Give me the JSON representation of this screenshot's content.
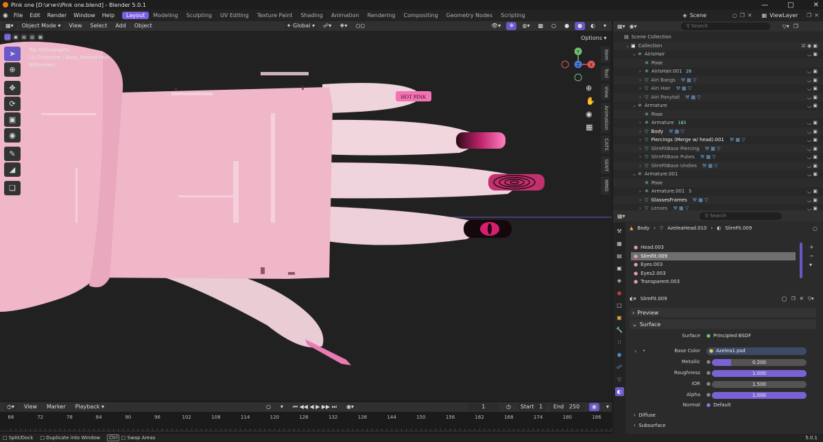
{
  "window": {
    "title": "Pink one [D:\\สาคร\\Pink one.blend] - Blender 5.0.1"
  },
  "menu": [
    "File",
    "Edit",
    "Render",
    "Window",
    "Help"
  ],
  "workspaces": [
    "Layout",
    "Modeling",
    "Sculpting",
    "UV Editing",
    "Texture Paint",
    "Shading",
    "Animation",
    "Rendering",
    "Compositing",
    "Geometry Nodes",
    "Scripting"
  ],
  "scene": {
    "scene": "Scene",
    "view_layer": "ViewLayer"
  },
  "viewport": {
    "mode": "Object Mode",
    "menus": [
      "View",
      "Select",
      "Add",
      "Object"
    ],
    "orientation": "Global",
    "options": "Options",
    "info": [
      "Top Orthographic",
      "(1) Collection | Body_Heeled-Foot",
      "Millimeters"
    ],
    "nail_label": "HOT PINK",
    "gizmo": {
      "y": "Y",
      "z": "Z",
      "x": "X"
    },
    "sidebar_tabs": [
      "Item",
      "Tool",
      "View",
      "Animation",
      "CATS",
      "SENT",
      "MMD"
    ]
  },
  "timeline": {
    "menus": [
      "View",
      "Marker",
      "Playback"
    ],
    "current_frame": "1",
    "start_label": "Start",
    "start": "1",
    "end_label": "End",
    "end": "250",
    "ticks": [
      "66",
      "72",
      "78",
      "84",
      "90",
      "96",
      "102",
      "108",
      "114",
      "120",
      "126",
      "132",
      "138",
      "144",
      "150",
      "156",
      "162",
      "168",
      "174",
      "180",
      "186"
    ]
  },
  "status": {
    "split": "Split/Dock",
    "duplicate": "Duplicate into Window",
    "ctrl": "Ctrl",
    "swap": "Swap Areas",
    "version": "5.0.1"
  },
  "outliner": {
    "search_placeholder": "Search",
    "rows": [
      {
        "indent": 0,
        "label": "Scene Collection",
        "kind": "scene"
      },
      {
        "indent": 1,
        "label": "Collection",
        "kind": "collection"
      },
      {
        "indent": 2,
        "label": "AirisHair",
        "kind": "armature"
      },
      {
        "indent": 3,
        "label": "Pose",
        "kind": "pose"
      },
      {
        "indent": 3,
        "label": "AirisHair.001",
        "kind": "armature",
        "extra": "29"
      },
      {
        "indent": 3,
        "label": "Airi Bangs",
        "kind": "mesh"
      },
      {
        "indent": 3,
        "label": "Airi Hair",
        "kind": "mesh"
      },
      {
        "indent": 3,
        "label": "Airi Ponytail",
        "kind": "mesh"
      },
      {
        "indent": 2,
        "label": "Armature",
        "kind": "armature"
      },
      {
        "indent": 3,
        "label": "Pose",
        "kind": "pose"
      },
      {
        "indent": 3,
        "label": "Armature",
        "kind": "armature",
        "extra": "183"
      },
      {
        "indent": 3,
        "label": "Body",
        "kind": "mesh"
      },
      {
        "indent": 3,
        "label": "Piercings (Merge w/ head).001",
        "kind": "mesh"
      },
      {
        "indent": 3,
        "label": "SlimFitBase Piercing",
        "kind": "mesh"
      },
      {
        "indent": 3,
        "label": "SlimFitBase Pubes",
        "kind": "mesh"
      },
      {
        "indent": 3,
        "label": "SlimFitBase Undies",
        "kind": "mesh"
      },
      {
        "indent": 2,
        "label": "Armature.001",
        "kind": "armature"
      },
      {
        "indent": 3,
        "label": "Pose",
        "kind": "pose"
      },
      {
        "indent": 3,
        "label": "Armature.001",
        "kind": "armature",
        "extra": "5"
      },
      {
        "indent": 3,
        "label": "GlassesFrames",
        "kind": "mesh"
      },
      {
        "indent": 3,
        "label": "Lenses",
        "kind": "mesh"
      }
    ]
  },
  "properties": {
    "search_placeholder": "Search",
    "breadcrumb": [
      "Body",
      "AzeleaHead.010",
      "SlimFit.009"
    ],
    "slots": [
      "Head.003",
      "SlimFit.009",
      "Eyes.003",
      "Eyes2.003",
      "Transparent.003"
    ],
    "selected_slot": 1,
    "material_name": "SlimFit.009",
    "preview": "Preview",
    "surface": "Surface",
    "fields": [
      {
        "label": "Surface",
        "value": "Principled BSDF",
        "type": "link"
      },
      {
        "label": "Base Color",
        "value": "Azelea1.psd",
        "type": "image"
      },
      {
        "label": "Metallic",
        "value": "0.200",
        "fill": 0.2
      },
      {
        "label": "Roughness",
        "value": "1.000",
        "fill": 1.0
      },
      {
        "label": "IOR",
        "value": "1.500",
        "fill": 0
      },
      {
        "label": "Alpha",
        "value": "1.000",
        "fill": 1.0
      },
      {
        "label": "Normal",
        "value": "Default",
        "type": "link"
      }
    ],
    "diffuse": "Diffuse",
    "subsurface": "Subsurface"
  },
  "colors": {
    "accent": "#7b5ee0",
    "skin": "#f0c7d4",
    "sleeve": "#f2a4c2"
  }
}
